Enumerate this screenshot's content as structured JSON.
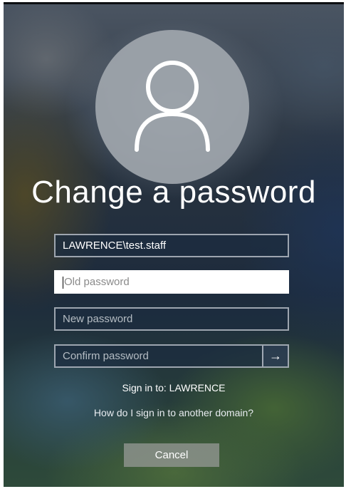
{
  "screen": {
    "title": "Change a password"
  },
  "form": {
    "username": {
      "value": "LAWRENCE\\test.staff"
    },
    "old_password": {
      "placeholder": "Old password"
    },
    "new_password": {
      "placeholder": "New password"
    },
    "confirm_password": {
      "placeholder": "Confirm password",
      "submit_icon": "arrow-right-icon",
      "submit_glyph": "→"
    }
  },
  "sign_in_to": "Sign in to: LAWRENCE",
  "other_domain_link": "How do I sign in to another domain?",
  "cancel_label": "Cancel",
  "avatar_icon": "user-icon",
  "colors": {
    "text": "#ffffff",
    "field_bg": "#1c2c40",
    "active_field_bg": "#ffffff",
    "cancel_bg": "#8c928c"
  }
}
